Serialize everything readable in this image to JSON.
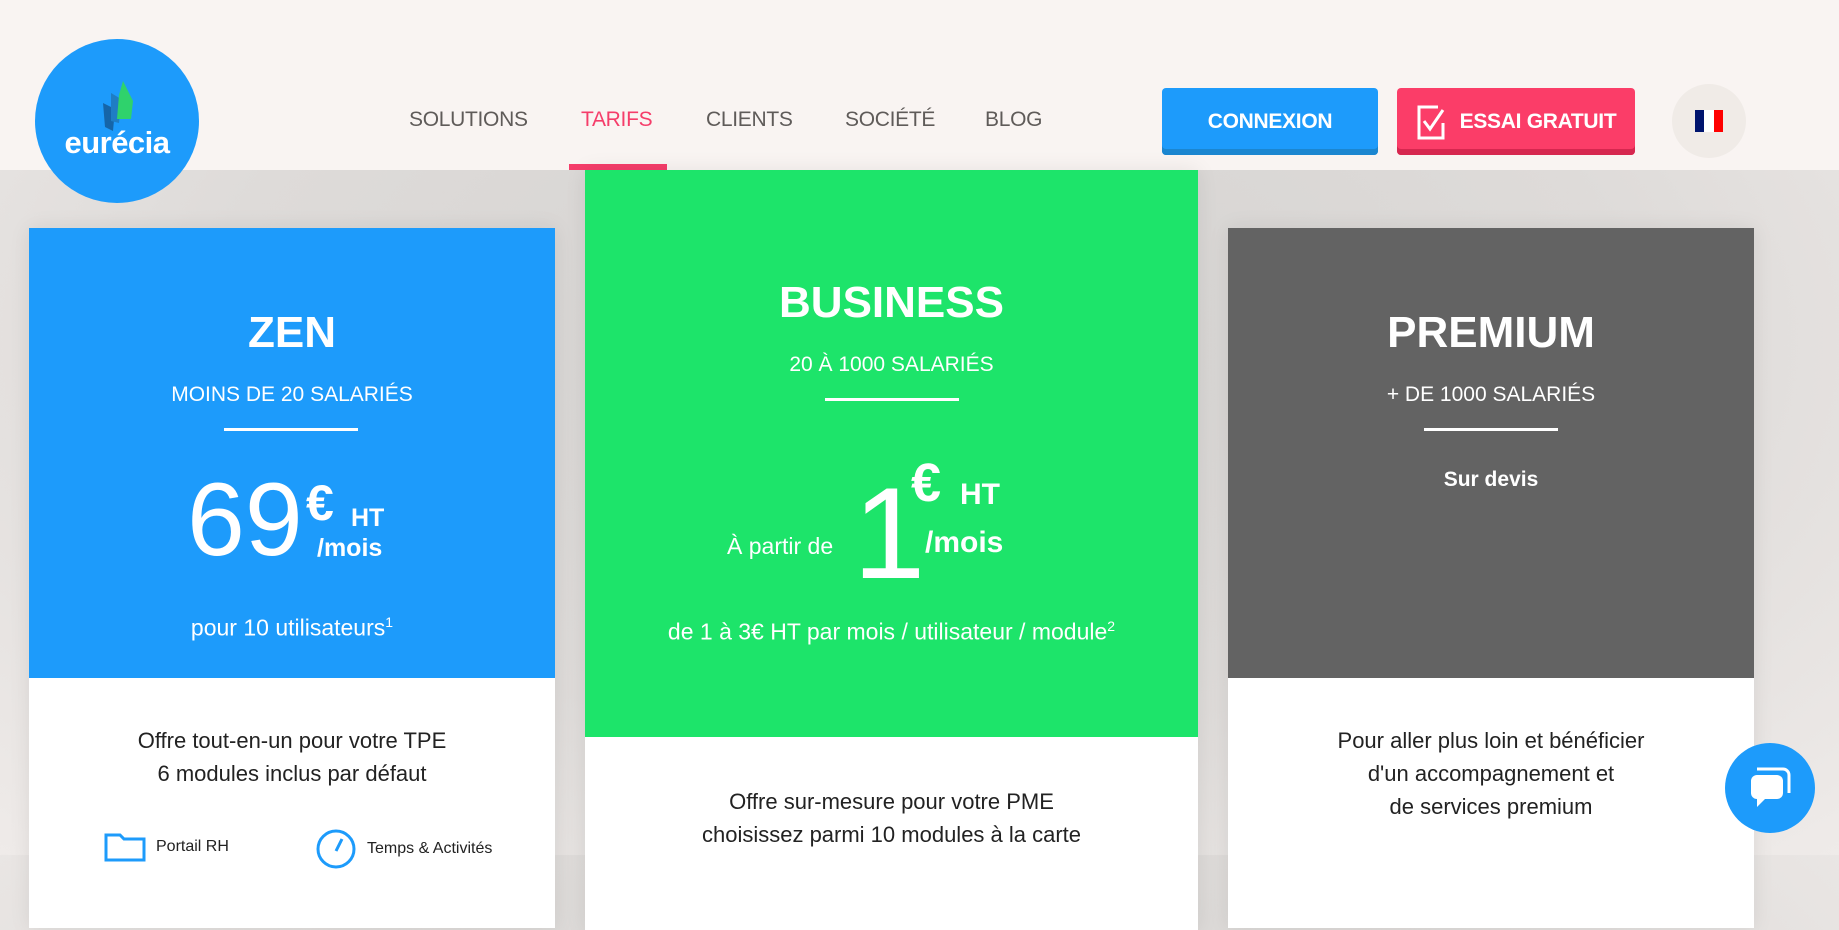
{
  "header": {
    "logo_text": "eurécia",
    "nav": [
      {
        "label": "SOLUTIONS"
      },
      {
        "label": "TARIFS",
        "active": true
      },
      {
        "label": "CLIENTS"
      },
      {
        "label": "SOCIÉTÉ"
      },
      {
        "label": "BLOG"
      }
    ],
    "login_label": "CONNEXION",
    "trial_label": "ESSAI GRATUIT",
    "language": "fr-flag-icon"
  },
  "colors": {
    "brand_blue": "#1d9bfb",
    "accent_pink": "#f53d6a",
    "business_green": "#1de46a",
    "premium_gray": "#636363"
  },
  "plans": [
    {
      "name": "ZEN",
      "subtitle": "MOINS DE 20 SALARIÉS",
      "price": "69",
      "currency": "€",
      "tax": "HT",
      "period": "/mois",
      "note": "pour 10 utilisateurs",
      "note_sup": "1",
      "description": [
        "Offre tout-en-un pour votre TPE",
        "6 modules inclus par défaut"
      ],
      "modules": [
        {
          "icon": "folder-icon",
          "label": "Portail RH"
        },
        {
          "icon": "clock-icon",
          "label": "Temps & Activités"
        }
      ]
    },
    {
      "name": "BUSINESS",
      "subtitle": "20 À 1000 SALARIÉS",
      "price_prefix": "À partir de",
      "price": "1",
      "currency": "€",
      "tax": "HT",
      "period": "/mois",
      "note": "de 1 à 3€ HT par mois / utilisateur / module",
      "note_sup": "2",
      "description": [
        "Offre sur-mesure pour votre PME",
        "choisissez parmi 10 modules à la carte"
      ]
    },
    {
      "name": "PREMIUM",
      "subtitle": "+ DE 1000 SALARIÉS",
      "price_text": "Sur devis",
      "description": [
        "Pour aller plus loin et bénéficier",
        "d'un accompagnement et",
        "de services premium"
      ]
    }
  ],
  "chat": {
    "icon": "chat-bubble-icon"
  }
}
